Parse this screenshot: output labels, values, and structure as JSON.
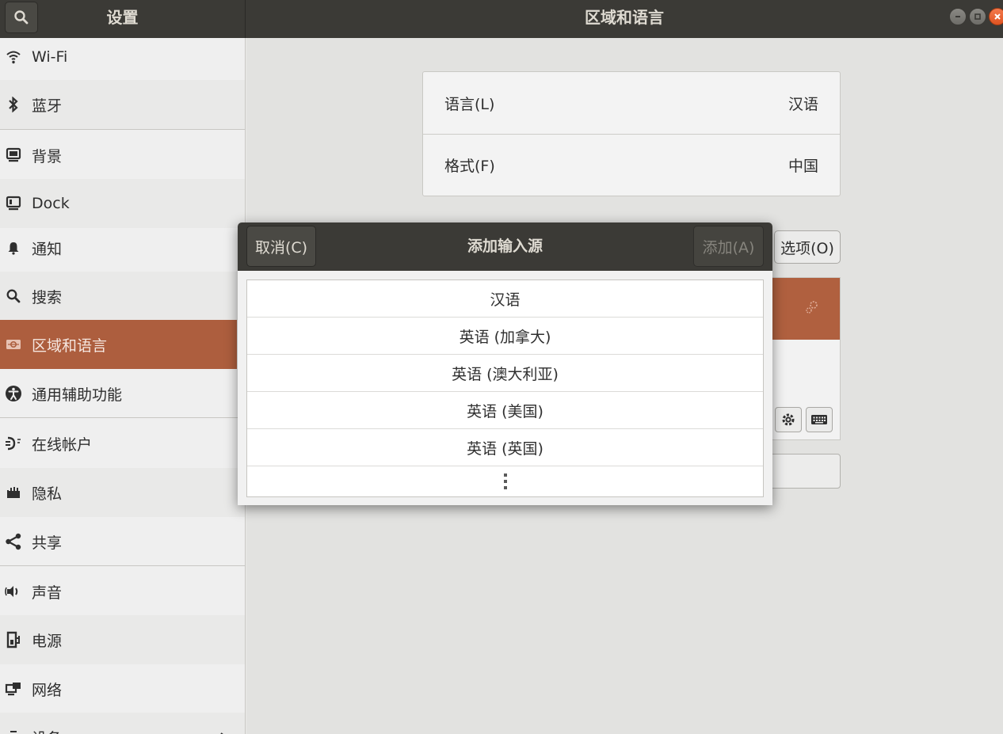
{
  "app": {
    "left_title": "设置",
    "right_title": "区域和语言"
  },
  "sidebar": {
    "items": [
      {
        "label": "Wi-Fi",
        "icon": "wifi-icon"
      },
      {
        "label": "蓝牙",
        "icon": "bluetooth-icon"
      },
      {
        "label": "背景",
        "icon": "background-icon"
      },
      {
        "label": "Dock",
        "icon": "dock-icon"
      },
      {
        "label": "通知",
        "icon": "bell-icon"
      },
      {
        "label": "搜索",
        "icon": "search-icon"
      },
      {
        "label": "区域和语言",
        "icon": "region-language-icon"
      },
      {
        "label": "通用辅助功能",
        "icon": "accessibility-icon"
      },
      {
        "label": "在线帐户",
        "icon": "online-accounts-icon"
      },
      {
        "label": "隐私",
        "icon": "privacy-hand-icon"
      },
      {
        "label": "共享",
        "icon": "share-icon"
      },
      {
        "label": "声音",
        "icon": "speaker-icon"
      },
      {
        "label": "电源",
        "icon": "power-icon"
      },
      {
        "label": "网络",
        "icon": "network-icon"
      },
      {
        "label": "设备",
        "icon": "devices-icon"
      }
    ],
    "active": "区域和语言"
  },
  "region": {
    "language_label": "语言(L)",
    "language_value": "汉语",
    "format_label": "格式(F)",
    "format_value": "中国",
    "options_button": "选项(O)"
  },
  "dialog": {
    "title": "添加输入源",
    "cancel": "取消(C)",
    "add": "添加(A)",
    "items": [
      "汉语",
      "英语 (加拿大)",
      "英语 (澳大利亚)",
      "英语 (美国)",
      "英语 (英国)"
    ],
    "more": "more-vertical-icon"
  },
  "colors": {
    "accent": "#ad5e3e",
    "headerbar": "#3b3a36",
    "close": "#e05421"
  }
}
